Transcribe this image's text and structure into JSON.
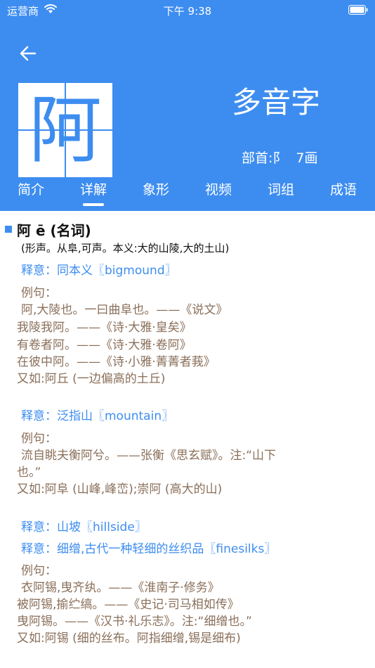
{
  "status_bar": {
    "carrier": "运营商",
    "time": "下午 9:38"
  },
  "colors": {
    "primary": "#3d8df0",
    "example_text": "#8a6f5a",
    "heading_text": "#111111"
  },
  "icons": {
    "back": "arrow-left-icon",
    "wifi": "wifi-icon",
    "battery": "battery-icon"
  },
  "character": {
    "glyph": "阿",
    "multi_sound": "多音字",
    "radical": "部首:阝",
    "strokes": "7画"
  },
  "tabs": [
    {
      "label": "简介"
    },
    {
      "label": "详解",
      "active": true
    },
    {
      "label": "象形"
    },
    {
      "label": "视频"
    },
    {
      "label": "词组"
    },
    {
      "label": "成语"
    }
  ],
  "entry": {
    "title": "阿  ē (名词)",
    "origin": "(形声。从阜,可声。本义:大的山陵,大的土山)",
    "lines": [
      "释意：同本义〖bigmound〗",
      "例句：",
      "阿,大陵也。一曰曲阜也。——《说文》",
      "我陵我阿。——《诗·大雅·皇矣》",
      "有卷者阿。——《诗·大雅·卷阿》",
      "在彼中阿。——《诗·小雅·菁菁者莪》",
      "又如:阿丘 (一边偏高的土丘)",
      "释意：泛指山〖mountain〗",
      "例句：",
      "流自眺夫衡阿兮。——张衡《思玄赋》。注:“山下",
      "也。”",
      "又如:阿阜 (山峰,峰峦);崇阿 (高大的山)",
      "释意：山坡〖hillside〗",
      "释意：细缯,古代一种轻细的丝织品〖finesilks〗",
      "例句：",
      "衣阿锡,曳齐纨。——《淮南子·修务》",
      "被阿锡,揄纻缟。——《史记·司马相如传》",
      "曳阿锡。——《汉书·礼乐志》。注:“细缯也。”",
      "又如:阿锡 (细的丝布。阿指细缯,锡是细布)"
    ]
  }
}
